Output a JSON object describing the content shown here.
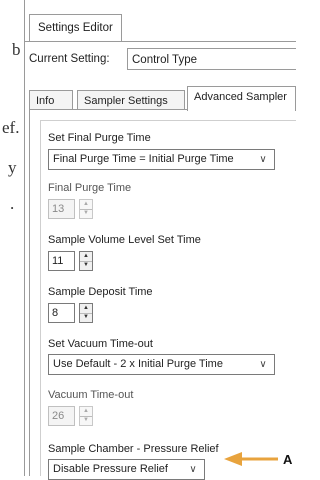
{
  "background_text": {
    "letters": [
      "b",
      "ef.",
      "y",
      "."
    ]
  },
  "window": {
    "title": "Settings Editor",
    "current_setting_label": "Current Setting:",
    "current_setting_value": "Control Type"
  },
  "tabs": [
    {
      "label": "Info",
      "active": false
    },
    {
      "label": "Sampler Settings",
      "active": false
    },
    {
      "label": "Advanced Sampler",
      "active": true
    }
  ],
  "fields": {
    "set_final_purge_time": {
      "label": "Set Final Purge Time",
      "value": "Final Purge Time = Initial Purge Time"
    },
    "final_purge_time": {
      "label": "Final Purge Time",
      "value": "13",
      "enabled": false
    },
    "sample_volume_level_set_time": {
      "label": "Sample Volume Level Set Time",
      "value": "11",
      "enabled": true
    },
    "sample_deposit_time": {
      "label": "Sample Deposit Time",
      "value": "8",
      "enabled": true
    },
    "set_vacuum_timeout": {
      "label": "Set Vacuum Time-out",
      "value": "Use Default - 2 x Initial Purge Time"
    },
    "vacuum_timeout": {
      "label": "Vacuum Time-out",
      "value": "26",
      "enabled": false
    },
    "sample_chamber_pressure_relief": {
      "label": "Sample Chamber - Pressure Relief",
      "value": "Disable Pressure Relief"
    }
  },
  "callout": {
    "label": "A",
    "color": "#e8a33d"
  }
}
